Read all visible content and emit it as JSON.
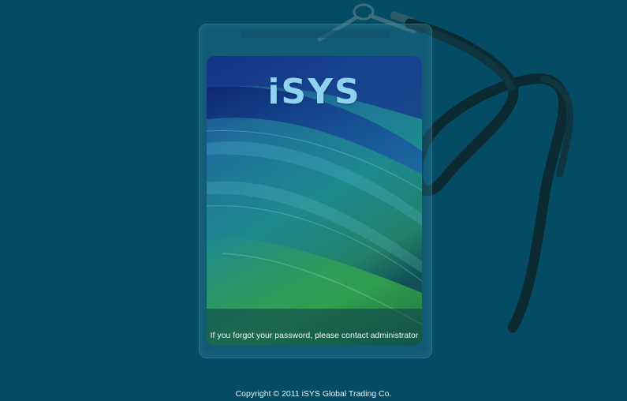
{
  "card": {
    "logo_text": "iSYS",
    "help_text": "If you forgot your password, please contact administrator"
  },
  "footer": {
    "copyright": "Copyright © 2011 iSYS Global Trading Co."
  },
  "colors": {
    "background": "#044c64",
    "card_blue": "#1b4fa8",
    "card_teal": "#1d8a8a",
    "card_green": "#2a9a3a",
    "logo": "#8fd3f0"
  },
  "icons": {
    "lanyard": "lanyard-icon",
    "clip": "clip-icon"
  }
}
